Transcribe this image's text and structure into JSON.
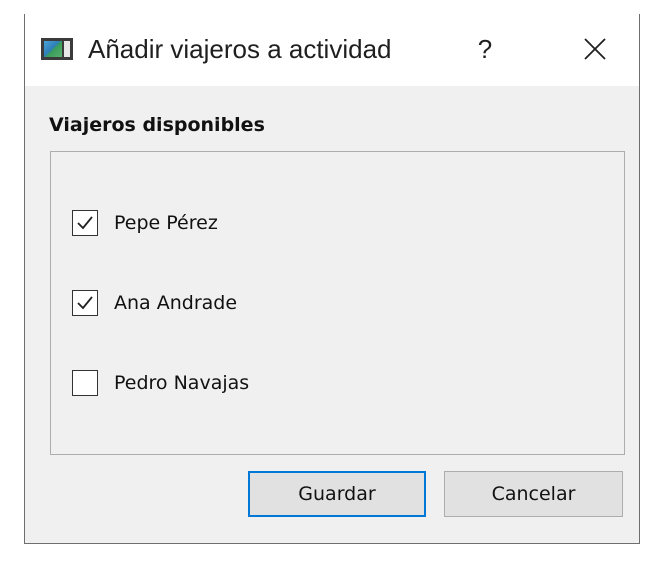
{
  "window": {
    "title": "Añadir viajeros a actividad",
    "help_label": "?"
  },
  "group": {
    "title": "Viajeros disponibles",
    "travelers": [
      {
        "name": "Pepe Pérez",
        "checked": true
      },
      {
        "name": "Ana Andrade",
        "checked": true
      },
      {
        "name": "Pedro Navajas",
        "checked": false
      }
    ]
  },
  "buttons": {
    "save_label": "Guardar",
    "cancel_label": "Cancelar"
  },
  "icons": {
    "app": "window-app-icon",
    "help": "help-question-icon",
    "close": "close-icon",
    "check": "checkmark-icon"
  },
  "colors": {
    "focus_border": "#0078d7",
    "button_face": "#e1e1e1",
    "dialog_background": "#f0f0f0"
  }
}
